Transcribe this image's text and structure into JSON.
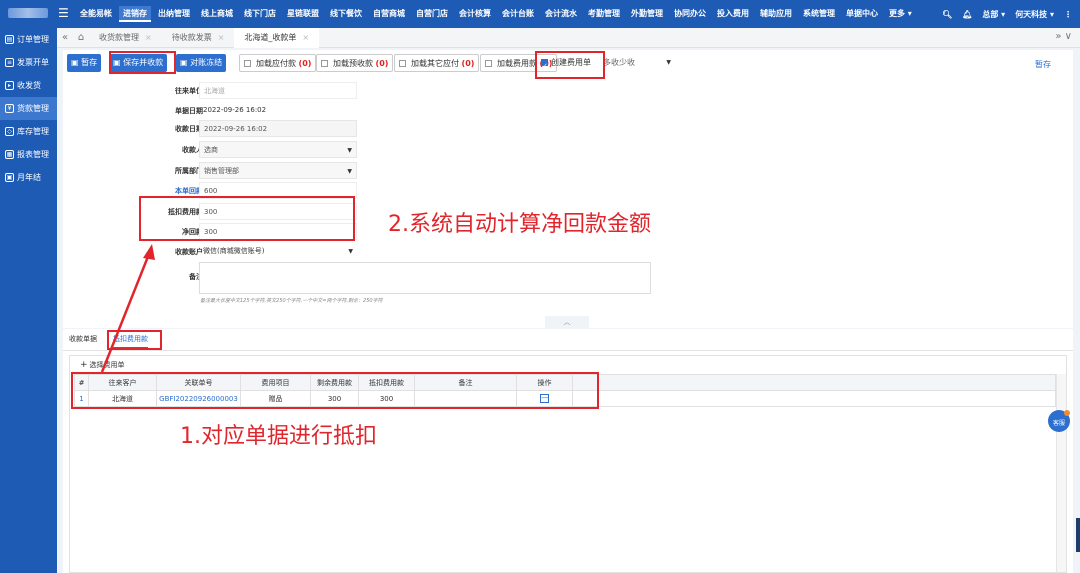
{
  "topnav": {
    "menu": [
      "全能易帐",
      "进销存",
      "出纳管理",
      "线上商城",
      "线下门店",
      "星链联盟",
      "线下餐饮",
      "自营商城",
      "自营门店",
      "会计核算",
      "会计台账",
      "会计流水",
      "考勤管理",
      "外勤管理",
      "协同办公",
      "投入费用",
      "辅助应用",
      "系统管理",
      "单据中心",
      "更多 ▾"
    ],
    "active_index": 1,
    "user": "总部 ▾",
    "company": "何天科技 ▾"
  },
  "sidebar": {
    "items": [
      "订单管理",
      "发票开单",
      "收发货",
      "货款管理",
      "库存管理",
      "报表管理",
      "月年结"
    ],
    "active_index": 3
  },
  "tabs": [
    {
      "label": "收货款管理",
      "active": false
    },
    {
      "label": "待收款发票",
      "active": false
    },
    {
      "label": "北海道_收款单",
      "active": true
    }
  ],
  "toolbar": {
    "save_draft": "暂存",
    "save_audit": "保存并收款",
    "reconcile": "对账冻结",
    "add_payable": "加载应付款",
    "add_payable_count": "(0)",
    "add_prepay": "加载预收款",
    "add_prepay_count": "(0)",
    "add_other": "加载其它应付",
    "add_other_count": "(0)",
    "add_expense": "加载费用款",
    "add_expense_count": "(0)",
    "create_expense": "创建费用单",
    "select_mode": "多收少收",
    "draft_link": "暂存"
  },
  "form": {
    "partner_label": "往来单位",
    "partner_value": "北海道",
    "bill_date_label": "单据日期",
    "bill_date_value": "2022-09-26 16:02",
    "receive_date_label": "收款日期",
    "receive_date_value": "2022-09-26 16:02",
    "receiver_label": "收款人",
    "receiver_value": "选商",
    "dept_label": "所属部门",
    "dept_value": "销售管理部",
    "this_receive_label": "本单回款",
    "this_receive_value": "600",
    "deduct_label": "抵扣费用款",
    "deduct_value": "300",
    "net_label": "净回款",
    "net_value": "300",
    "account_label": "收款账户",
    "account_value": "微信(商城微信账号)",
    "remark_label": "备注",
    "remark_hint": "备注最大长度中文125个字符,英文250个字符,一个中文=两个字符,剩余：250字符"
  },
  "bottom": {
    "tabs": [
      "收款单据",
      "抵扣费用款"
    ],
    "active_tab": 1,
    "add_link": "选择费用单",
    "columns": [
      "#",
      "往来客户",
      "关联单号",
      "费用项目",
      "剩余费用款",
      "抵扣费用款",
      "备注",
      "操作"
    ],
    "rows": [
      {
        "no": "1",
        "customer": "北海道",
        "bill_no": "GBFI20220926000003",
        "item": "赠品",
        "remain": "300",
        "deduct": "300",
        "remark": "",
        "op": "—"
      }
    ]
  },
  "annotations": {
    "step2": "2.系统自动计算净回款金额",
    "step1": "1.对应单据进行抵扣"
  },
  "kefu": "客服",
  "colors": {
    "brand": "#1d5bb5",
    "accent": "#2d6fcf",
    "annotation": "#e0262c"
  }
}
